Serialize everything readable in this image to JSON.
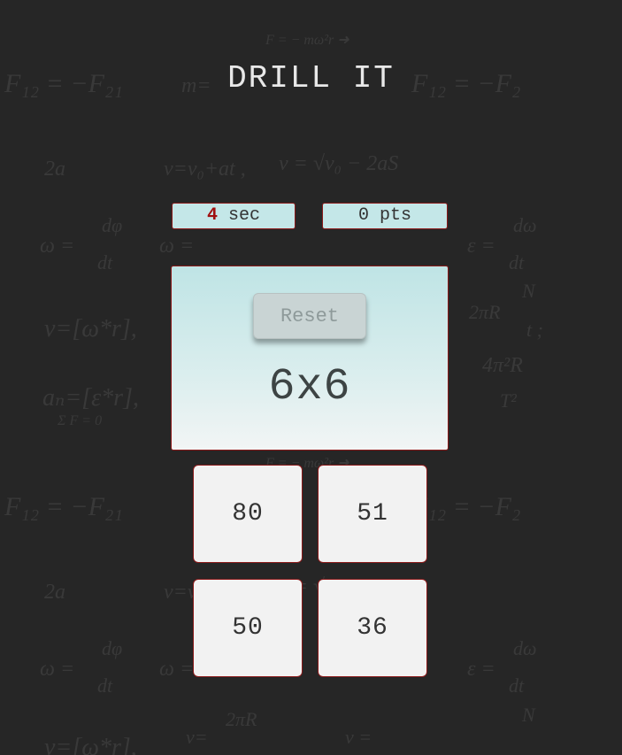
{
  "app": {
    "title": "DRILL IT"
  },
  "status": {
    "timer_value": "4",
    "timer_unit": "sec",
    "score_text": "0 pts"
  },
  "question": {
    "reset_label": "Reset",
    "expression": "6x6"
  },
  "answers": [
    {
      "label": "80"
    },
    {
      "label": "51"
    },
    {
      "label": "50"
    },
    {
      "label": "36"
    }
  ],
  "colors": {
    "background": "#262626",
    "panel_top": "#bfe4e5",
    "panel_bottom": "#f2f5f5",
    "border_accent": "#8b1a1a",
    "timer_accent": "#a01010",
    "answer_bg": "#f2f2f2"
  },
  "icons": [
    "physics-formulas-background"
  ]
}
